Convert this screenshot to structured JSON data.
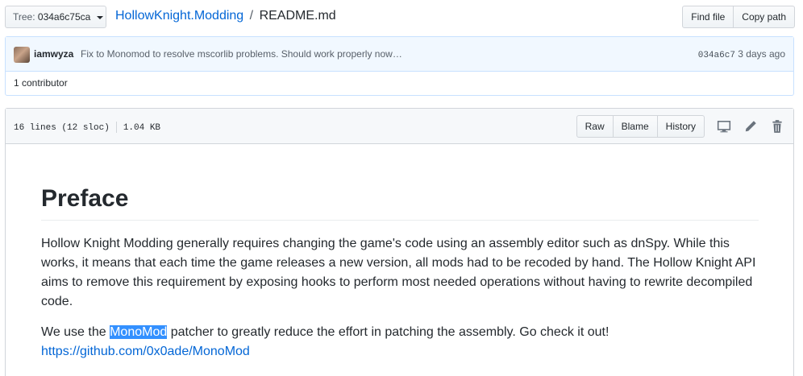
{
  "breadcrumb": {
    "tree_label": "Tree:",
    "tree_value": "034a6c75ca",
    "repo": "HollowKnight.Modding",
    "separator": "/",
    "file": "README.md"
  },
  "toolbar": {
    "find_file_label": "Find file",
    "copy_path_label": "Copy path"
  },
  "commit": {
    "author": "iamwyza",
    "message": "Fix to Monomod to resolve mscorlib problems. Should work properly now…",
    "sha": "034a6c7",
    "time": "3 days ago",
    "contributors": "1 contributor"
  },
  "file": {
    "lines": "16 lines (12 sloc)",
    "size": "1.04 KB",
    "raw_label": "Raw",
    "blame_label": "Blame",
    "history_label": "History"
  },
  "readme": {
    "heading": "Preface",
    "para1": "Hollow Knight Modding generally requires changing the game's code using an assembly editor such as dnSpy. While this works, it means that each time the game releases a new version, all mods had to be recoded by hand. The Hollow Knight API aims to remove this requirement by exposing hooks to perform most needed operations without having to rewrite decompiled code.",
    "para2_before": "We use the ",
    "para2_highlight": "MonoMod",
    "para2_after": " patcher to greatly reduce the effort in patching the assembly. Go check it out!",
    "link": "https://github.com/0x0ade/MonoMod"
  },
  "icons": {
    "desktop": "desktop-icon",
    "edit": "pencil-icon",
    "delete": "trash-icon"
  },
  "colors": {
    "link": "#0366d6",
    "selection": "#3390ff",
    "commit_bg": "#f1f8ff"
  }
}
